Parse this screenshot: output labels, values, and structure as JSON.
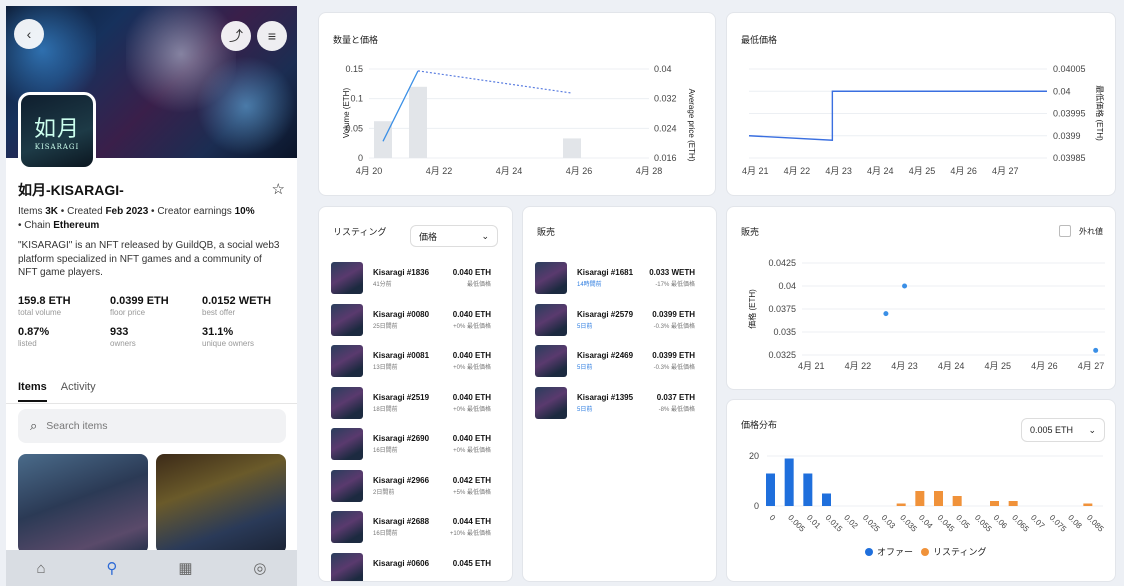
{
  "collection": {
    "name": "如月-KISARAGI-",
    "logo_kanji": "如月",
    "logo_text": "KISARAGI",
    "meta_items_label": "Items",
    "meta_items": "3K",
    "meta_created_label": "Created",
    "meta_created": "Feb 2023",
    "meta_earn_label": "Creator earnings",
    "meta_earn": "10%",
    "meta_chain_label": "Chain",
    "meta_chain": "Ethereum",
    "description": "\"KISARAGI\" is an NFT released by GuildQB, a social web3 platform specialized in NFT games and a community of NFT game players.",
    "stats": [
      {
        "value": "159.8 ETH",
        "label": "total volume"
      },
      {
        "value": "0.0399 ETH",
        "label": "floor price"
      },
      {
        "value": "0.0152 WETH",
        "label": "best offer"
      },
      {
        "value": "0.87%",
        "label": "listed"
      },
      {
        "value": "933",
        "label": "owners"
      },
      {
        "value": "31.1%",
        "label": "unique owners"
      }
    ],
    "tabs": [
      "Items",
      "Activity"
    ],
    "search_placeholder": "Search items"
  },
  "icons": {
    "back": "chevron-left-icon",
    "share": "share-icon",
    "filter": "filter-icon",
    "star": "star-icon",
    "search": "search-icon",
    "home": "home-icon",
    "nav_search": "search-icon",
    "calendar": "calendar-icon",
    "profile": "profile-icon"
  },
  "colors": {
    "accent": "#2f7ee0",
    "offer": "#1f6fdc",
    "listing": "#f0923a"
  },
  "volume_card": {
    "title": "数量と価格"
  },
  "floor_card": {
    "title": "最低価格"
  },
  "listing_card": {
    "title": "リスティング",
    "dropdown": "価格",
    "items": [
      {
        "name": "Kisaragi #1836",
        "time": "41分前",
        "price": "0.040 ETH",
        "diff": "最低価格"
      },
      {
        "name": "Kisaragi #0080",
        "time": "25日間前",
        "price": "0.040 ETH",
        "diff": "+0% 最低価格"
      },
      {
        "name": "Kisaragi #0081",
        "time": "13日間前",
        "price": "0.040 ETH",
        "diff": "+0% 最低価格"
      },
      {
        "name": "Kisaragi #2519",
        "time": "18日間前",
        "price": "0.040 ETH",
        "diff": "+0% 最低価格"
      },
      {
        "name": "Kisaragi #2690",
        "time": "16日間前",
        "price": "0.040 ETH",
        "diff": "+0% 最低価格"
      },
      {
        "name": "Kisaragi #2966",
        "time": "2日間前",
        "price": "0.042 ETH",
        "diff": "+5% 最低価格"
      },
      {
        "name": "Kisaragi #2688",
        "time": "16日間前",
        "price": "0.044 ETH",
        "diff": "+10% 最低価格"
      },
      {
        "name": "Kisaragi #0606",
        "time": "",
        "price": "0.045 ETH",
        "diff": ""
      }
    ]
  },
  "sales_list_card": {
    "title": "販売",
    "items": [
      {
        "name": "Kisaragi #1681",
        "time": "14時間前",
        "price": "0.033 WETH",
        "diff": "-17% 最低価格"
      },
      {
        "name": "Kisaragi #2579",
        "time": "5日前",
        "price": "0.0399 ETH",
        "diff": "-0.3% 最低価格"
      },
      {
        "name": "Kisaragi #2469",
        "time": "5日前",
        "price": "0.0399 ETH",
        "diff": "-0.3% 最低価格"
      },
      {
        "name": "Kisaragi #1395",
        "time": "5日前",
        "price": "0.037 ETH",
        "diff": "-8% 最低価格"
      }
    ]
  },
  "sales_chart_card": {
    "title": "販売",
    "outlier_label": "外れ値"
  },
  "dist_card": {
    "title": "価格分布",
    "dropdown": "0.005 ETH"
  },
  "chart_data": [
    {
      "type": "bar",
      "title": "数量と価格",
      "x_ticks": [
        "4月 20",
        "4月 22",
        "4月 24",
        "4月 26",
        "4月 28"
      ],
      "ylabel": "Volume (ETH)",
      "y2label": "Average price (ETH)",
      "y_ticks": [
        "0",
        "0.05",
        "0.1",
        "0.15"
      ],
      "y2_ticks": [
        "0.016",
        "0.024",
        "0.032",
        "0.04"
      ],
      "ylim": [
        0,
        0.15
      ],
      "y2lim": [
        0.016,
        0.04
      ],
      "xlim": [
        20,
        28
      ],
      "bars": [
        {
          "x": 20.4,
          "y": 0.062
        },
        {
          "x": 21.4,
          "y": 0.12
        },
        {
          "x": 25.8,
          "y": 0.033
        }
      ],
      "price_line": [
        {
          "x": 20.4,
          "y": 0.0205
        },
        {
          "x": 21.4,
          "y": 0.0395
        }
      ],
      "price_dotted": [
        {
          "x": 21.4,
          "y": 0.0395
        },
        {
          "x": 25.8,
          "y": 0.0335
        }
      ]
    },
    {
      "type": "line",
      "title": "最低価格",
      "x_ticks": [
        "4月 21",
        "4月 22",
        "4月 23",
        "4月 24",
        "4月 25",
        "4月 26",
        "4月 27"
      ],
      "ylabel": "最低価格 (ETH)",
      "y_ticks": [
        "0.03985",
        "0.0399",
        "0.03995",
        "0.04",
        "0.04005"
      ],
      "ylim": [
        0.03985,
        0.04005
      ],
      "xlim": [
        20.85,
        28
      ],
      "points": [
        {
          "x": 20.85,
          "y": 0.0399
        },
        {
          "x": 22.85,
          "y": 0.03989
        },
        {
          "x": 22.85,
          "y": 0.04
        },
        {
          "x": 28,
          "y": 0.04
        }
      ]
    },
    {
      "type": "scatter",
      "title": "販売",
      "x_ticks": [
        "4月 21",
        "4月 22",
        "4月 23",
        "4月 24",
        "4月 25",
        "4月 26",
        "4月 27"
      ],
      "ylabel": "価格 (ETH)",
      "y_ticks": [
        "0.0325",
        "0.035",
        "0.0375",
        "0.04",
        "0.0425"
      ],
      "ylim": [
        0.0325,
        0.0425
      ],
      "xlim": [
        20.8,
        27.3
      ],
      "points": [
        {
          "x": 22.6,
          "y": 0.037
        },
        {
          "x": 23.0,
          "y": 0.04
        },
        {
          "x": 27.1,
          "y": 0.033
        }
      ]
    },
    {
      "type": "bar",
      "title": "価格分布",
      "x_ticks": [
        "0",
        "0.005",
        "0.01",
        "0.015",
        "0.02",
        "0.025",
        "0.03",
        "0.035",
        "0.04",
        "0.045",
        "0.05",
        "0.055",
        "0.06",
        "0.065",
        "0.07",
        "0.075",
        "0.08",
        "0.085"
      ],
      "y_ticks": [
        "0",
        "20"
      ],
      "ylim": [
        0,
        20
      ],
      "series": [
        {
          "name": "オファー",
          "color": "#1f6fdc",
          "values": [
            13,
            19,
            13,
            5,
            0,
            0,
            0,
            0,
            0,
            0,
            0,
            0,
            0,
            0,
            0,
            0,
            0,
            0
          ]
        },
        {
          "name": "リスティング",
          "color": "#f0923a",
          "values": [
            0,
            0,
            0,
            0,
            0,
            0,
            0,
            1,
            6,
            6,
            4,
            0,
            2,
            2,
            0,
            0,
            0,
            1
          ]
        }
      ]
    }
  ]
}
